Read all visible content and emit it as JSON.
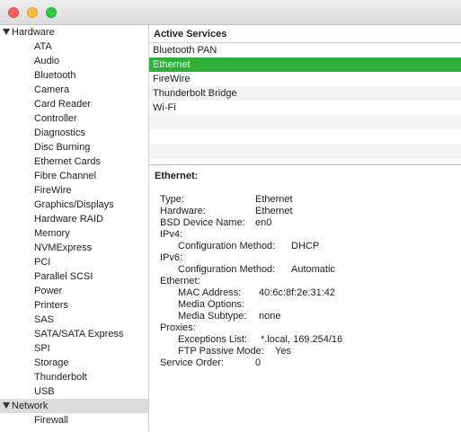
{
  "window": {
    "traffic_lights": {
      "close": "#fc605c",
      "minimize": "#fdbc40",
      "zoom": "#34c84a"
    }
  },
  "sidebar": {
    "hardware_label": "Hardware",
    "hardware_items": [
      "ATA",
      "Audio",
      "Bluetooth",
      "Camera",
      "Card Reader",
      "Controller",
      "Diagnostics",
      "Disc Burning",
      "Ethernet Cards",
      "Fibre Channel",
      "FireWire",
      "Graphics/Displays",
      "Hardware RAID",
      "Memory",
      "NVMExpress",
      "PCI",
      "Parallel SCSI",
      "Power",
      "Printers",
      "SAS",
      "SATA/SATA Express",
      "SPI",
      "Storage",
      "Thunderbolt",
      "USB"
    ],
    "network_label": "Network",
    "network_items": [
      "Firewall"
    ]
  },
  "services": {
    "header": "Active Services",
    "items": [
      "Bluetooth PAN",
      "Ethernet",
      "FireWire",
      "Thunderbolt Bridge",
      "Wi-Fi"
    ],
    "selected": "Ethernet",
    "selection_color": "#2fae3a"
  },
  "details": {
    "title": "Ethernet:",
    "type_k": "Type:",
    "type_v": "Ethernet",
    "hardware_k": "Hardware:",
    "hardware_v": "Ethernet",
    "bsd_k": "BSD Device Name:",
    "bsd_v": "en0",
    "ipv4_k": "IPv4:",
    "ipv4_method_k": "Configuration Method:",
    "ipv4_method_v": "DHCP",
    "ipv6_k": "IPv6:",
    "ipv6_method_k": "Configuration Method:",
    "ipv6_method_v": "Automatic",
    "eth_k": "Ethernet:",
    "mac_k": "MAC Address:",
    "mac_v": "40:6c:8f:2e:31:42",
    "media_options_k": "Media Options:",
    "media_subtype_k": "Media Subtype:",
    "media_subtype_v": "none",
    "proxies_k": "Proxies:",
    "exceptions_k": "Exceptions List:",
    "exceptions_v": "*.local, 169.254/16",
    "ftp_k": "FTP Passive Mode:",
    "ftp_v": "Yes",
    "order_k": "Service Order:",
    "order_v": "0"
  }
}
